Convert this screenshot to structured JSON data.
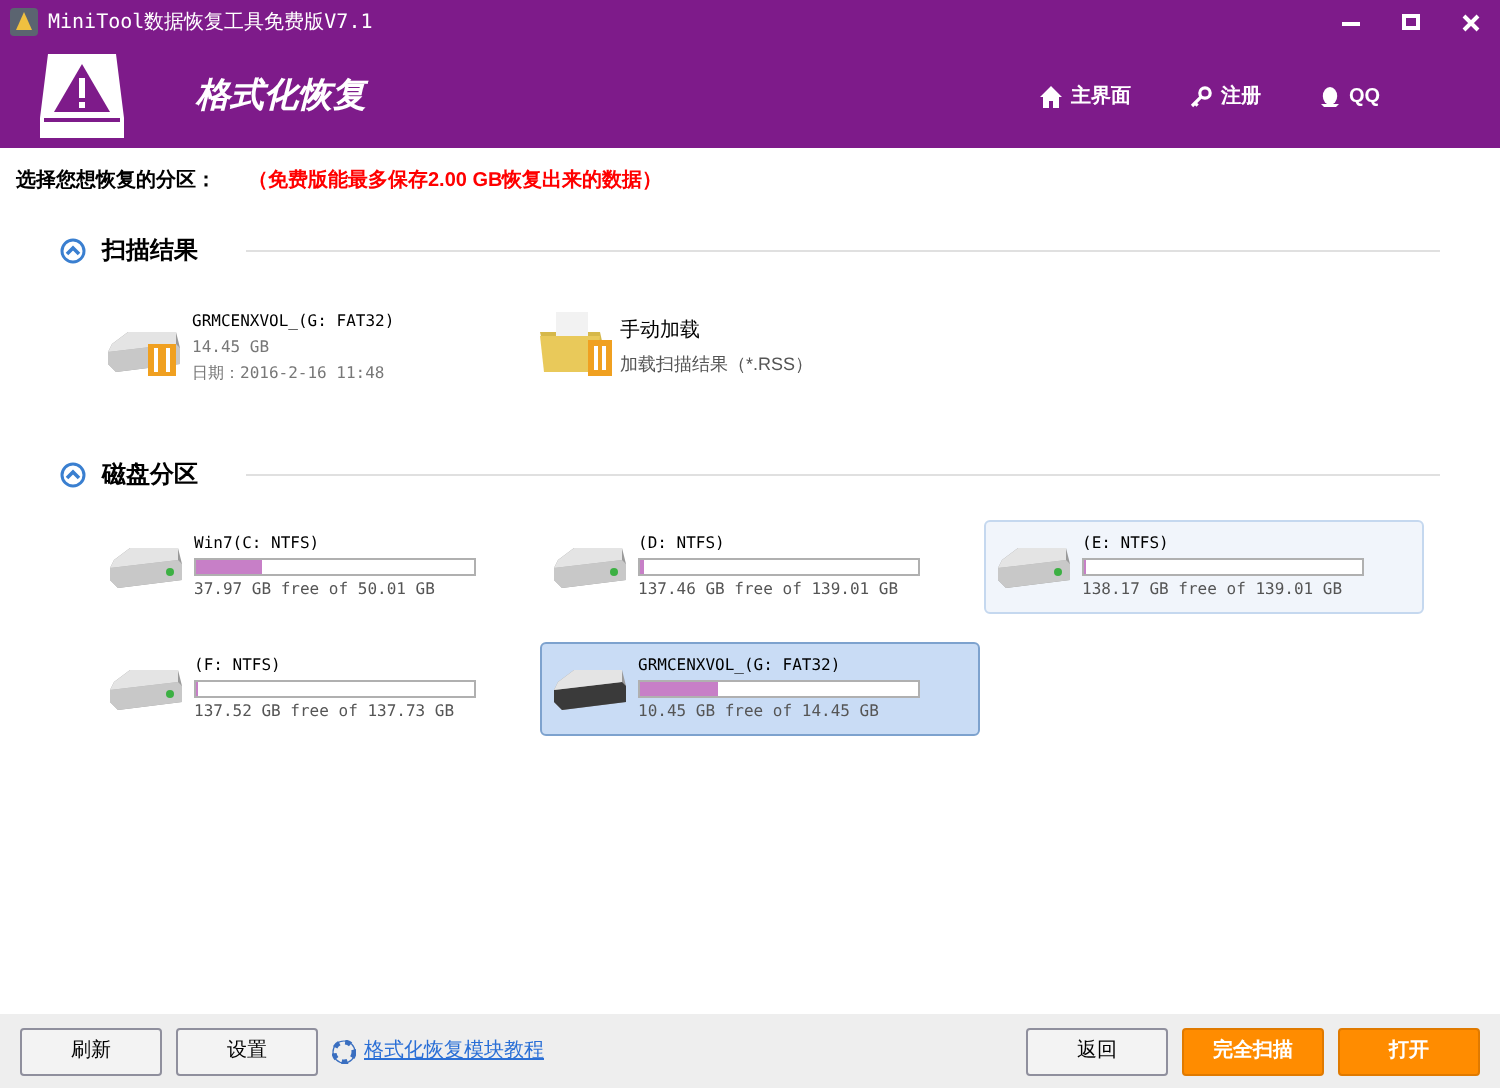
{
  "window": {
    "title": "MiniTool数据恢复工具免费版V7.1"
  },
  "header": {
    "title": "格式化恢复",
    "nav": [
      {
        "kind": "home",
        "label": "主界面"
      },
      {
        "kind": "key",
        "label": "注册"
      },
      {
        "kind": "qq",
        "label": "QQ"
      }
    ]
  },
  "prompt": {
    "label": "选择您想恢复的分区：",
    "notice": "（免费版能最多保存2.00 GB恢复出来的数据）"
  },
  "scan_results": {
    "title": "扫描结果",
    "expanded": true,
    "items": [
      {
        "kind": "drive",
        "name": "GRMCENXVOL_(G: FAT32)",
        "size": "14.45 GB",
        "date": "日期：2016-2-16 11:48"
      },
      {
        "kind": "folder",
        "name": "手动加载",
        "description": "加载扫描结果（*.RSS）"
      }
    ]
  },
  "partitions": {
    "title": "磁盘分区",
    "expanded": true,
    "items": [
      {
        "name": "Win7(C: NTFS)",
        "level": 0.24,
        "free": "37.97 GB free of 50.01 GB",
        "selected": false,
        "hovered": false,
        "removable": false
      },
      {
        "name": "(D: NTFS)",
        "level": 0.011,
        "free": "137.46 GB free of 139.01 GB",
        "selected": false,
        "hovered": false,
        "removable": false
      },
      {
        "name": "(E: NTFS)",
        "level": 0.006,
        "free": "138.17 GB free of 139.01 GB",
        "selected": false,
        "hovered": true,
        "removable": false
      },
      {
        "name": "(F: NTFS)",
        "level": 0.002,
        "free": "137.52 GB free of 137.73 GB",
        "selected": false,
        "hovered": false,
        "removable": false
      },
      {
        "name": "GRMCENXVOL_(G: FAT32)",
        "level": 0.277,
        "free": "10.45 GB free of 14.45 GB",
        "selected": true,
        "hovered": false,
        "removable": true
      }
    ]
  },
  "footer": {
    "left_buttons": [
      "刷新",
      "设置"
    ],
    "help_link": "格式化恢复模块教程",
    "back": "返回",
    "primary_buttons": [
      "完全扫描",
      "打开"
    ]
  }
}
